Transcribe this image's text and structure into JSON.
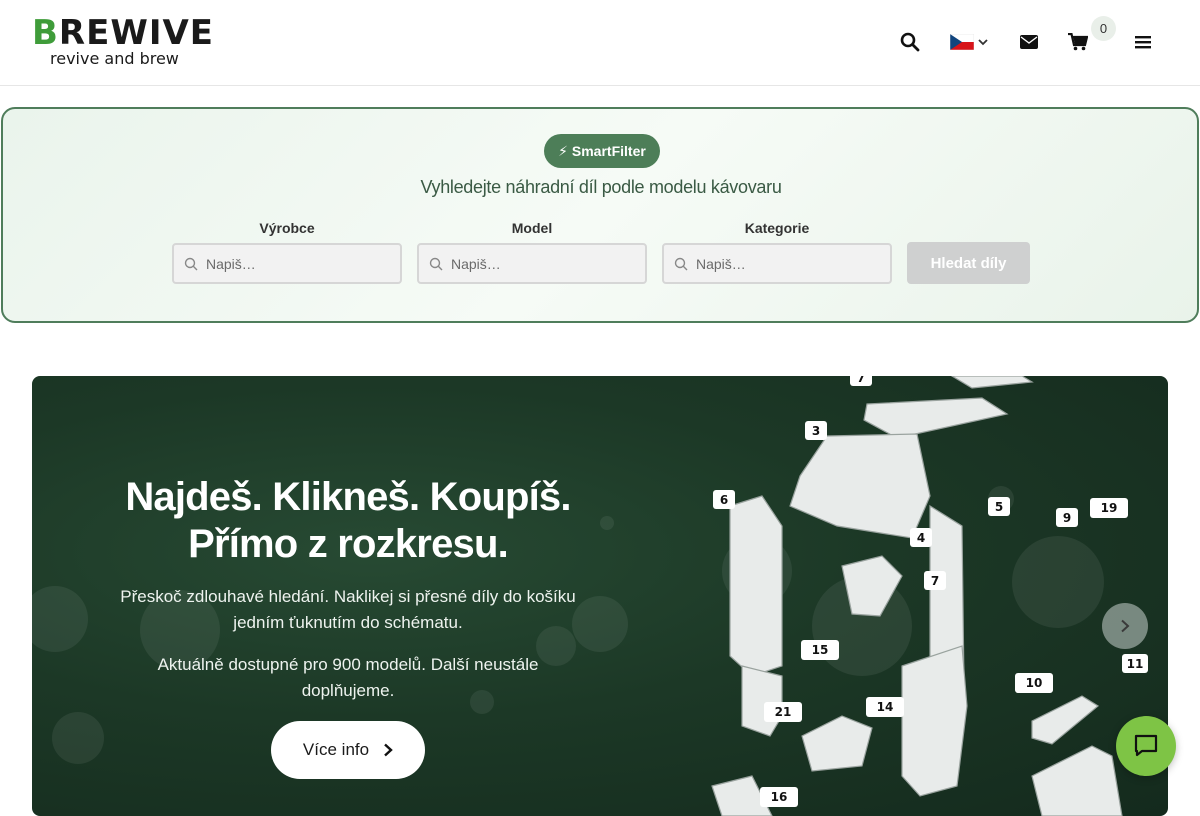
{
  "header": {
    "logo_word": "BREWIVE",
    "logo_tagline": "revive and brew",
    "cart_count": "0",
    "icons": [
      "search-icon",
      "flag-cz-icon",
      "chevron-down-icon",
      "envelope-icon",
      "cart-icon",
      "menu-icon"
    ]
  },
  "smartfilter": {
    "badge": "⚡ SmartFilter",
    "subtitle": "Vyhledejte náhradní díl podle modelu kávovaru",
    "fields": [
      {
        "label": "Výrobce",
        "placeholder": "Napiš…"
      },
      {
        "label": "Model",
        "placeholder": "Napiš…"
      },
      {
        "label": "Kategorie",
        "placeholder": "Napiš…"
      }
    ],
    "button": "Hledat díly"
  },
  "hero": {
    "title_line1": "Najdeš. Klikneš. Koupíš.",
    "title_line2": "Přímo z rozkresu.",
    "paragraph1": "Přeskoč zdlouhavé hledání. Naklikej si přesné díly do košíku jedním ťuknutím do schématu.",
    "paragraph2": "Aktuálně dostupné pro 900 modelů. Další neustále doplňujeme.",
    "button": "Více info",
    "diagram_labels": [
      "7",
      "3",
      "6",
      "5",
      "9",
      "19",
      "4",
      "7",
      "15",
      "10",
      "11",
      "21",
      "14",
      "16"
    ]
  },
  "colors": {
    "brand_green": "#3f9c3a",
    "filter_border": "#4f7d5b",
    "hero_bg": "#1c3826",
    "chat_green": "#7ec445"
  }
}
